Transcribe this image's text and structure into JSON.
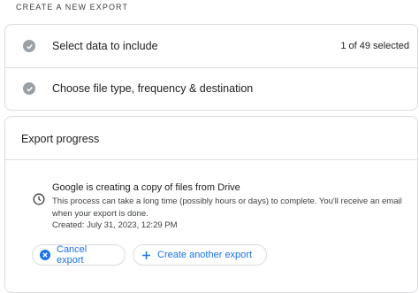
{
  "section": {
    "title": "CREATE A NEW EXPORT"
  },
  "steps": [
    {
      "label": "Select data to include",
      "meta": "1 of 49 selected",
      "icon": "check-icon"
    },
    {
      "label": "Choose file type, frequency & destination",
      "meta": "",
      "icon": "check-icon"
    }
  ],
  "progress": {
    "title": "Export progress",
    "message_title": "Google is creating a copy of files from Drive",
    "message_body": "This process can take a long time (possibly hours or days) to complete. You'll receive an email when your export is done.",
    "created": "Created: July 31, 2023, 12:29 PM",
    "icon": "clock-icon"
  },
  "actions": {
    "cancel_label": "Cancel export",
    "create_label": "Create another export"
  },
  "colors": {
    "accent": "#1a73e8",
    "border": "#dadce0",
    "check": "#9aa0a6"
  }
}
